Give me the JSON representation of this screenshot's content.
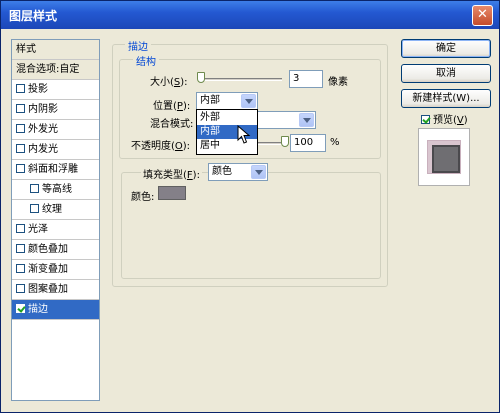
{
  "window": {
    "title": "图层样式",
    "close_glyph": "✕"
  },
  "style_list": {
    "header": "样式",
    "items": [
      {
        "label": "混合选项:自定",
        "checkbox": false,
        "checked": false,
        "selected": false,
        "indent": false
      },
      {
        "label": "投影",
        "checkbox": true,
        "checked": false,
        "selected": false,
        "indent": false
      },
      {
        "label": "内阴影",
        "checkbox": true,
        "checked": false,
        "selected": false,
        "indent": false
      },
      {
        "label": "外发光",
        "checkbox": true,
        "checked": false,
        "selected": false,
        "indent": false
      },
      {
        "label": "内发光",
        "checkbox": true,
        "checked": false,
        "selected": false,
        "indent": false
      },
      {
        "label": "斜面和浮雕",
        "checkbox": true,
        "checked": false,
        "selected": false,
        "indent": false
      },
      {
        "label": "等高线",
        "checkbox": true,
        "checked": false,
        "selected": false,
        "indent": true
      },
      {
        "label": "纹理",
        "checkbox": true,
        "checked": false,
        "selected": false,
        "indent": true
      },
      {
        "label": "光泽",
        "checkbox": true,
        "checked": false,
        "selected": false,
        "indent": false
      },
      {
        "label": "颜色叠加",
        "checkbox": true,
        "checked": false,
        "selected": false,
        "indent": false
      },
      {
        "label": "渐变叠加",
        "checkbox": true,
        "checked": false,
        "selected": false,
        "indent": false
      },
      {
        "label": "图案叠加",
        "checkbox": true,
        "checked": false,
        "selected": false,
        "indent": false
      },
      {
        "label": "描边",
        "checkbox": true,
        "checked": true,
        "selected": true,
        "indent": false
      }
    ]
  },
  "stroke": {
    "group_title": "描边",
    "structure_title": "结构",
    "size_label": "大小(",
    "size_key": "S",
    "size_label_end": "):",
    "size_value": "3",
    "size_unit": "像素",
    "position_label": "位置(",
    "position_key": "P",
    "position_label_end": "):",
    "position_value": "内部",
    "position_options": [
      "外部",
      "内部",
      "居中"
    ],
    "position_options_active": 1,
    "blend_label": "混合模式:",
    "blend_value": "",
    "opacity_label": "不透明度(",
    "opacity_key": "O",
    "opacity_label_end": "):",
    "opacity_value": "100",
    "opacity_unit": "%",
    "fill_type_label": "填充类型(",
    "fill_type_key": "F",
    "fill_type_label_end": "):",
    "fill_type_value": "颜色",
    "color_label": "颜色:",
    "color_value": "#848088"
  },
  "buttons": {
    "ok": "确定",
    "cancel": "取消",
    "new_style": "新建样式(W)...",
    "preview_label": "预览(",
    "preview_key": "V",
    "preview_label_end": ")",
    "preview_checked": true
  },
  "colors": {
    "title_bar": "#2459d2",
    "selection": "#316ac5",
    "group_title": "#0046d5"
  }
}
